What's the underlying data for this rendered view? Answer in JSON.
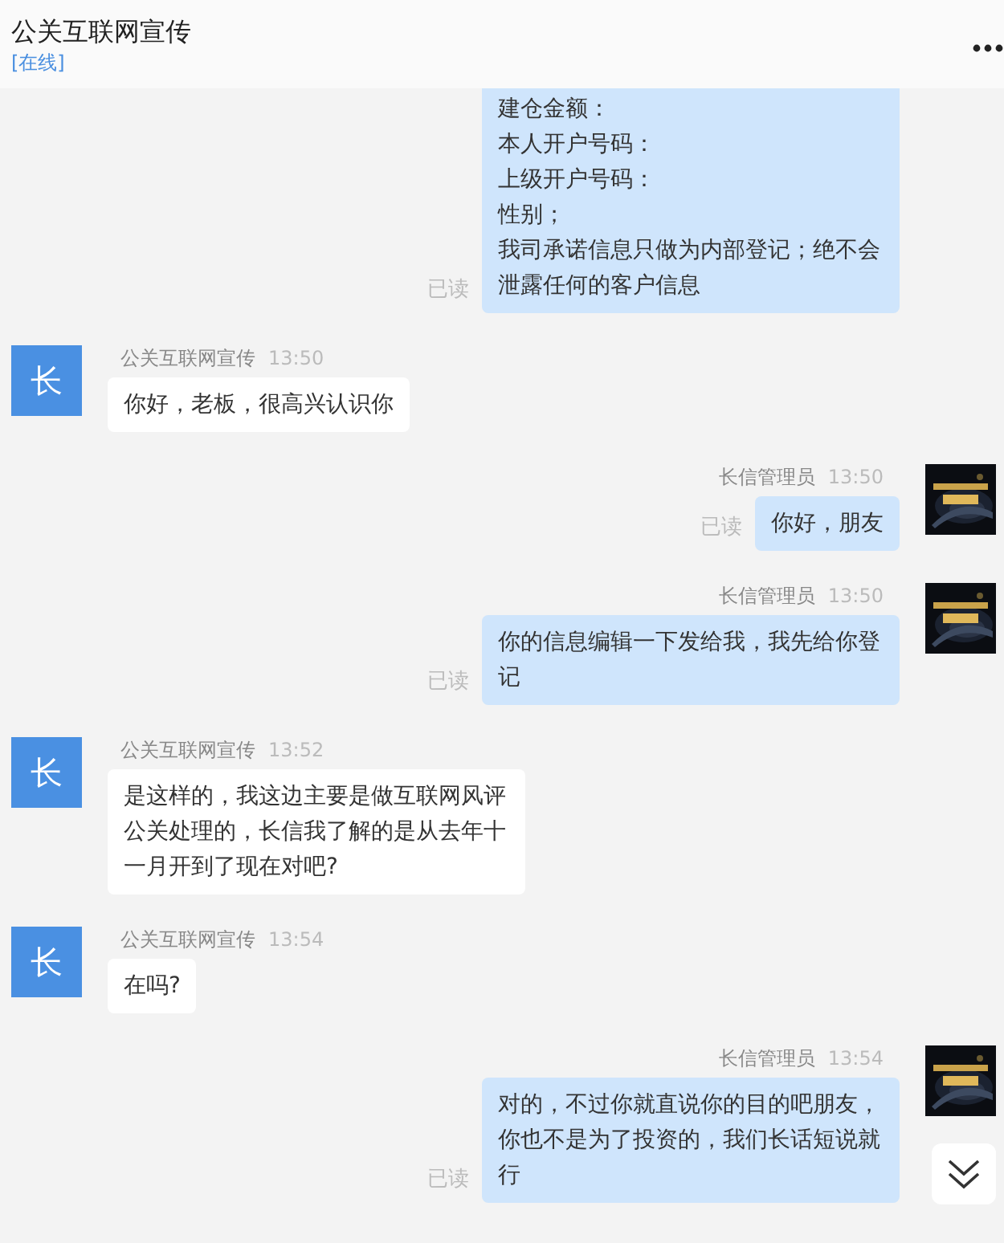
{
  "header": {
    "title": "公关互联网宣传",
    "status": "[在线]"
  },
  "messages": [
    {
      "kind": "out",
      "lines": [
        "建仓金额：",
        "本人开户号码：",
        "上级开户号码：",
        "性别；",
        "我司承诺信息只做为内部登记；绝不会泄露任何的客户信息"
      ],
      "read": "已读"
    },
    {
      "kind": "in",
      "avatar": "长",
      "name": "公关互联网宣传",
      "time": "13:50",
      "lines": [
        "你好，老板，很高兴认识你"
      ]
    },
    {
      "kind": "out",
      "name": "长信管理员",
      "time": "13:50",
      "lines": [
        "你好，朋友"
      ],
      "read": "已读"
    },
    {
      "kind": "out",
      "name": "长信管理员",
      "time": "13:50",
      "lines": [
        "你的信息编辑一下发给我，我先给你登记"
      ],
      "read": "已读"
    },
    {
      "kind": "in",
      "avatar": "长",
      "name": "公关互联网宣传",
      "time": "13:52",
      "lines": [
        "是这样的，我这边主要是做互联网风评公关处理的，长信我了解的是从去年十一月开到了现在对吧?"
      ]
    },
    {
      "kind": "in",
      "avatar": "长",
      "name": "公关互联网宣传",
      "time": "13:54",
      "lines": [
        "在吗?"
      ]
    },
    {
      "kind": "out",
      "name": "长信管理员",
      "time": "13:54",
      "lines": [
        "对的，不过你就直说你的目的吧朋友，你也不是为了投资的，我们长话短说就行"
      ],
      "read": "已读"
    }
  ]
}
